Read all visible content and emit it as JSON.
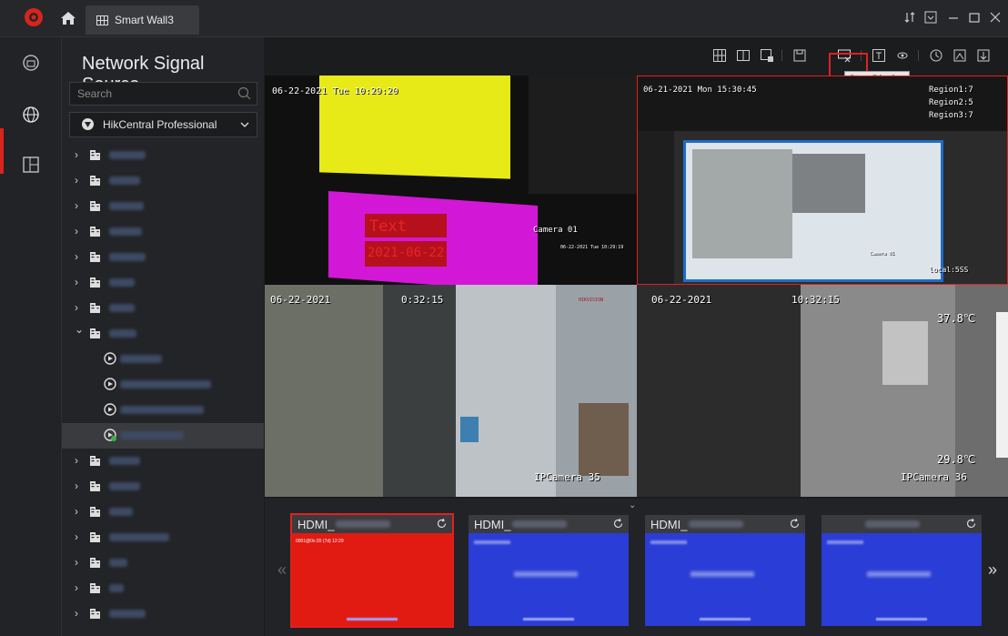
{
  "titlebar": {
    "tab_label": "Smart Wall3"
  },
  "panel": {
    "title": "Network Signal Source",
    "search_placeholder": "Search",
    "source_selected": "HikCentral Professional",
    "tree": [
      {
        "type": "folder",
        "expanded": false
      },
      {
        "type": "folder",
        "expanded": false
      },
      {
        "type": "folder",
        "expanded": false
      },
      {
        "type": "folder",
        "expanded": false
      },
      {
        "type": "folder",
        "expanded": false
      },
      {
        "type": "folder",
        "expanded": false
      },
      {
        "type": "folder",
        "expanded": false
      },
      {
        "type": "folder",
        "expanded": true
      },
      {
        "type": "camera"
      },
      {
        "type": "camera"
      },
      {
        "type": "camera"
      },
      {
        "type": "camera",
        "selected": true
      },
      {
        "type": "folder",
        "expanded": false
      },
      {
        "type": "folder",
        "expanded": false
      },
      {
        "type": "folder",
        "expanded": false
      },
      {
        "type": "folder",
        "expanded": false
      },
      {
        "type": "folder",
        "expanded": false
      },
      {
        "type": "folder",
        "expanded": false
      },
      {
        "type": "folder",
        "expanded": false
      }
    ]
  },
  "toolbar": {
    "icons": [
      "layout-icon",
      "split-icon",
      "screen-icon",
      "save-icon",
      "stop-display-icon",
      "text-icon",
      "eye-icon",
      "clock-icon",
      "scene-icon",
      "export-icon"
    ],
    "tooltip": "Stop Display"
  },
  "video": {
    "cell1": {
      "timestamp": "06-22-2021 Tue 10:29:20",
      "overlay_text": "Text",
      "overlay_date": "2021-06-22",
      "camera": "Camera 01",
      "small_ts": "06-22-2021 Tue 10:29:19"
    },
    "cell2": {
      "timestamp": "06-21-2021 Mon 15:30:45",
      "regions": [
        "Region1:7",
        "Region2:5",
        "Region3:7"
      ],
      "inner_camera": "Camera 01",
      "footer": "local:5SS"
    },
    "cell3": {
      "date": "06-22-2021",
      "time": "0:32:15",
      "camera": "IPCamera 35",
      "brand": "HIKVISION"
    },
    "cell4": {
      "date": "06-22-2021",
      "time": "10:32:15",
      "temp_high": "37.8℃",
      "temp_low": "29.8℃",
      "camera": "IPCamera 36"
    }
  },
  "strip": {
    "cards": [
      {
        "title": "HDMI_",
        "body_color": "#e11a12",
        "small_line": "0001@0x:20 (7d) 12:29"
      },
      {
        "title": "HDMI_",
        "body_color": "#2a3dd6"
      },
      {
        "title": "HDMI_",
        "body_color": "#2a3dd6"
      },
      {
        "title": "",
        "body_color": "#2a3dd6"
      }
    ]
  },
  "colors": {
    "accent": "#d9241b",
    "highlight_border": "#e02020"
  }
}
